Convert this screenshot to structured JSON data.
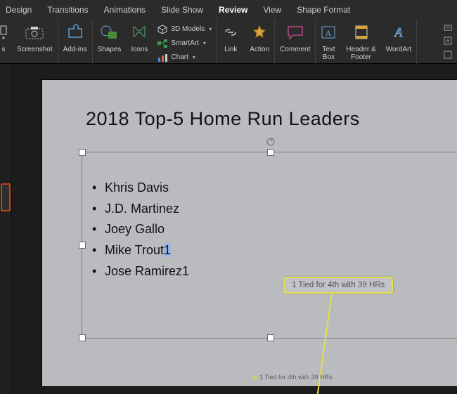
{
  "tabs": {
    "design": "Design",
    "transitions": "Transitions",
    "animations": "Animations",
    "slideshow": "Slide Show",
    "review": "Review",
    "view": "View",
    "shapeformat": "Shape Format"
  },
  "ribbon": {
    "screenshot_label": "Screenshot",
    "addins_label": "Add-ins",
    "shapes_label": "Shapes",
    "icons_label": "Icons",
    "models_label": "3D Models",
    "smartart_label": "SmartArt",
    "chart_label": "Chart",
    "link_label": "Link",
    "action_label": "Action",
    "comment_label": "Comment",
    "textbox_label": "Text\nBox",
    "headerfooter_label": "Header &\nFooter",
    "wordart_label": "WordArt"
  },
  "slide": {
    "title": "2018 Top-5 Home Run Leaders",
    "items": [
      "Khris Davis",
      "J.D. Martinez",
      "Joey Gallo",
      "Mike Trout",
      "Jose Ramirez"
    ],
    "super_mark": "1",
    "footnote_text": "1 Tied for 4th with 39 HRs",
    "footnote_small": "1 Tied for 4th with 39 HRs"
  }
}
